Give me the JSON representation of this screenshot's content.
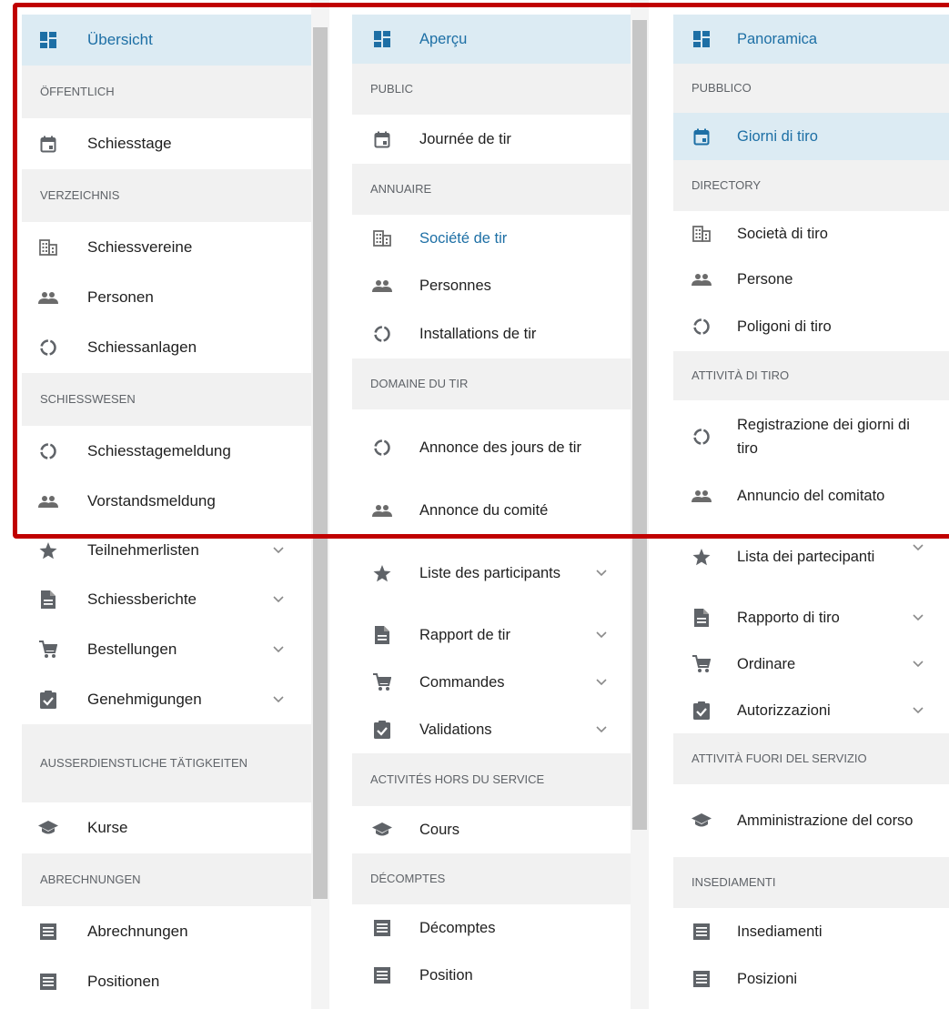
{
  "colors": {
    "accent": "#1d6fa5",
    "active_bg": "#dcebf3",
    "header_bg": "#f1f1f1",
    "highlight_frame": "#c00000"
  },
  "german": {
    "overview": "Übersicht",
    "public_header": "ÖFFENTLICH",
    "shooting_days": "Schiesstage",
    "directory_header": "VERZEICHNIS",
    "clubs": "Schiessvereine",
    "persons": "Personen",
    "ranges": "Schiessanlagen",
    "shooting_header": "SCHIESSWESEN",
    "day_report": "Schiesstagemeldung",
    "board_report": "Vorstandsmeldung",
    "participant_lists": "Teilnehmerlisten",
    "shooting_reports": "Schiessberichte",
    "orders": "Bestellungen",
    "approvals": "Genehmigungen",
    "offduty_header": "AUSSERDIENSTLICHE TÄTIGKEITEN",
    "courses": "Kurse",
    "billing_header": "ABRECHNUNGEN",
    "billings": "Abrechnungen",
    "positions": "Positionen"
  },
  "french": {
    "overview": "Aperçu",
    "public_header": "PUBLIC",
    "shooting_days": "Journée de tir",
    "directory_header": "ANNUAIRE",
    "clubs": "Société de tir",
    "persons": "Personnes",
    "ranges": "Installations de tir",
    "shooting_header": "DOMAINE DU TIR",
    "day_report": "Annonce des jours de tir",
    "board_report": "Annonce du comité",
    "participant_lists": "Liste des participants",
    "shooting_reports": "Rapport de tir",
    "orders": "Commandes",
    "approvals": "Validations",
    "offduty_header": "ACTIVITÉS HORS DU SERVICE",
    "courses": "Cours",
    "billing_header": "DÉCOMPTES",
    "billings": "Décomptes",
    "positions": "Position"
  },
  "italian": {
    "overview": "Panoramica",
    "public_header": "PUBBLICO",
    "shooting_days": "Giorni di tiro",
    "directory_header": "DIRECTORY",
    "clubs": "Società di tiro",
    "persons": "Persone",
    "ranges": "Poligoni di tiro",
    "shooting_header": "ATTIVITÀ DI TIRO",
    "day_report": "Registrazione dei giorni di tiro",
    "board_report": "Annuncio del comitato",
    "participant_lists": "Lista dei partecipanti",
    "shooting_reports": "Rapporto di tiro",
    "orders": "Ordinare",
    "approvals": "Autorizzazioni",
    "offduty_header": "ATTIVITÀ FUORI DEL SERVIZIO",
    "courses": "Amministrazione del corso",
    "billing_header": "INSEDIAMENTI",
    "billings": "Insediamenti",
    "positions": "Posizioni"
  }
}
